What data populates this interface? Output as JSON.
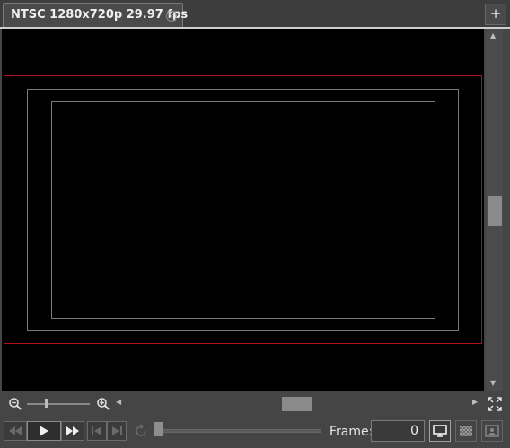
{
  "tab": {
    "title": "NTSC 1280x720p 29.97 fps"
  },
  "add_tab_label": "+",
  "frame": {
    "label": "Frame:",
    "value": "0"
  },
  "colors": {
    "overscan_frame": "#b01018",
    "safe_guides": "#7a7a7a",
    "background": "#454545",
    "viewport": "#000000"
  },
  "icons": {
    "tab_close": "close-circle-icon",
    "zoom_out": "zoom-out-icon",
    "zoom_in": "zoom-in-icon",
    "fullscreen": "fullscreen-icon",
    "rewind": "rewind-icon",
    "play": "play-icon",
    "fast_forward": "fast-forward-icon",
    "go_start": "skip-to-start-icon",
    "go_end": "skip-to-end-icon",
    "loop": "loop-icon",
    "monitor": "monitor-icon",
    "checker": "checkerboard-icon",
    "preview": "preview-icon"
  }
}
